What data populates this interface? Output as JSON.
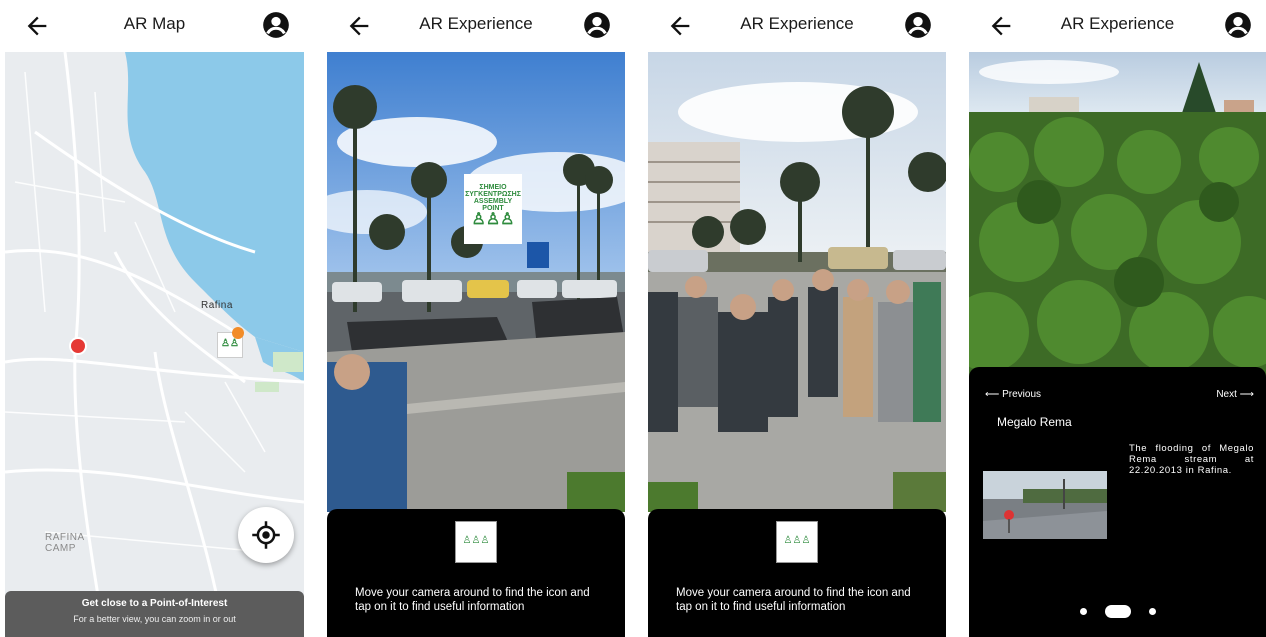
{
  "screens": [
    {
      "title": "AR Map",
      "map": {
        "place_label": "Rafina",
        "camp_label": "RAFINA\nCAMP",
        "banner_title": "Get close to a Point-of-Interest",
        "banner_subtitle": "For a better view, you can zoom in or out"
      }
    },
    {
      "title": "AR Experience",
      "sign_line1": "ΣΗΜΕΙΟ",
      "sign_line2": "ΣΥΓΚΕΝΤΡΩΣΗΣ",
      "sign_line3": "ASSEMBLY POINT",
      "hint": "Move your camera around to find the icon and tap on it to find useful information"
    },
    {
      "title": "AR Experience",
      "hint": "Move your camera around to find the icon and tap on it to find useful information"
    },
    {
      "title": "AR Experience",
      "detail": {
        "previous": "Previous",
        "next": "Next",
        "name": "Megalo Rema",
        "description": "The flooding of Megalo Rema stream at 22.20.2013 in Rafina."
      }
    }
  ],
  "icons": {
    "back": "arrow-left-icon",
    "account": "account-circle-icon",
    "locate": "my-location-icon"
  },
  "colors": {
    "sea": "#8cc9e9",
    "pin": "#e53935",
    "poi": "#f28c28",
    "panel": "#000000",
    "banner": "#5c5c5c",
    "sign_green": "#2e8b3d"
  }
}
